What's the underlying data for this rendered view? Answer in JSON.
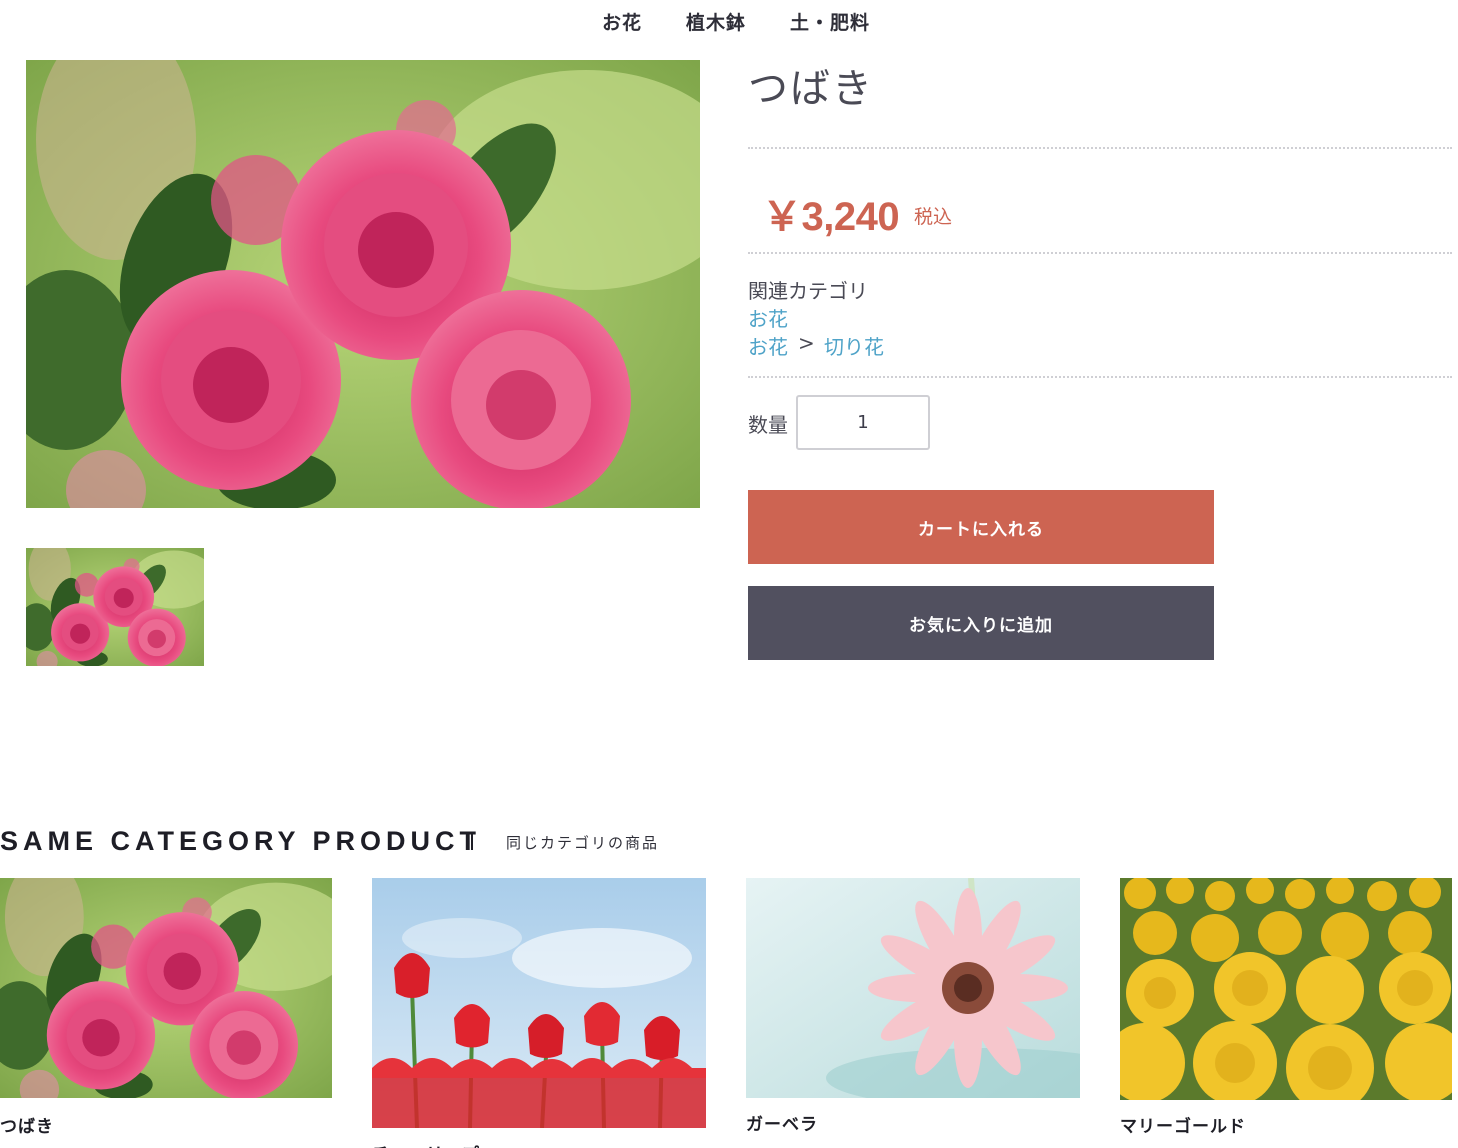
{
  "nav": {
    "items": [
      "お花",
      "植木鉢",
      "土・肥料"
    ]
  },
  "product": {
    "title": "つばき",
    "price": "￥3,240",
    "tax_label": "税込",
    "related_category_heading": "関連カテゴリ",
    "categories": {
      "link1": "お花",
      "link2_parent": "お花",
      "separator": ">",
      "link2_child": "切り花"
    },
    "quantity_label": "数量",
    "quantity_value": "1",
    "add_to_cart": "カートに入れる",
    "add_to_favorites": "お気に入りに追加"
  },
  "same_category": {
    "title": "SAME CATEGORY PRODUCT",
    "subtitle": "同じカテゴリの商品",
    "items": [
      {
        "name": "つばき",
        "image": "camellia-photo"
      },
      {
        "name": "チューリップ",
        "image": "tulip-photo"
      },
      {
        "name": "ガーベラ",
        "image": "gerbera-photo"
      },
      {
        "name": "マリーゴールド",
        "image": "marigold-photo"
      }
    ]
  },
  "colors": {
    "accent": "#cd6452",
    "secondary_button": "#51505f",
    "link": "#4fa3c8",
    "text": "#3d3d4a"
  }
}
